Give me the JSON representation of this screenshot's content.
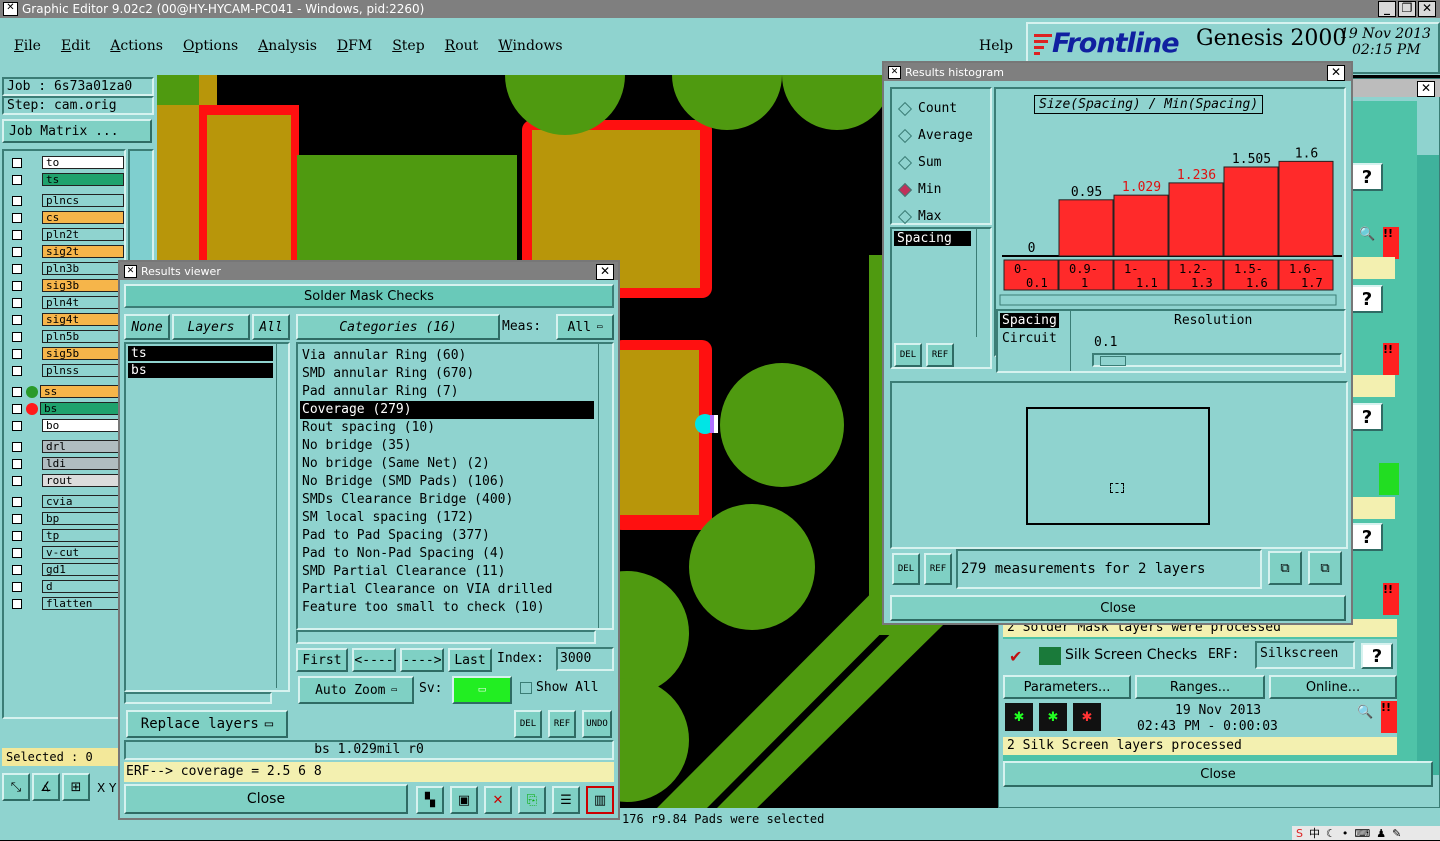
{
  "window": {
    "title": "Graphic Editor 9.02c2 (00@HY-HYCAM-PC041 - Windows, pid:2260)"
  },
  "menu": [
    "File",
    "Edit",
    "Actions",
    "Options",
    "Analysis",
    "DFM",
    "Step",
    "Rout",
    "Windows"
  ],
  "help": "Help",
  "brand": {
    "logo": "Frontline",
    "product": "Genesis 2000",
    "date": "19 Nov 2013",
    "time": "02:15 PM"
  },
  "left_panel": {
    "job": "Job : 6s73a01za0",
    "step": "Step: cam.orig",
    "job_matrix": "Job Matrix ...",
    "layers": [
      {
        "name": "to",
        "color": "#ffffff"
      },
      {
        "name": "ts",
        "color": "#1fa26d"
      },
      {
        "name": "plncs",
        "color": "#8fd3cf"
      },
      {
        "name": "cs",
        "color": "#f6b54a"
      },
      {
        "name": "pln2t",
        "color": "#8fd3cf"
      },
      {
        "name": "sig2t",
        "color": "#f6b54a"
      },
      {
        "name": "pln3b",
        "color": "#8fd3cf"
      },
      {
        "name": "sig3b",
        "color": "#f6b54a"
      },
      {
        "name": "pln4t",
        "color": "#8fd3cf"
      },
      {
        "name": "sig4t",
        "color": "#f6b54a"
      },
      {
        "name": "pln5b",
        "color": "#8fd3cf"
      },
      {
        "name": "sig5b",
        "color": "#f6b54a"
      },
      {
        "name": "plnss",
        "color": "#8fd3cf"
      },
      {
        "name": "ss",
        "color": "#f6b54a"
      },
      {
        "name": "bs",
        "color": "#1fa26d"
      },
      {
        "name": "bo",
        "color": "#ffffff"
      },
      {
        "name": "drl",
        "color": "#b0bcc0"
      },
      {
        "name": "ldi",
        "color": "#b0bcc0"
      },
      {
        "name": "rout",
        "color": "#dcdcdc"
      },
      {
        "name": "cvia",
        "color": "#8fd3cf"
      },
      {
        "name": "bp",
        "color": "#8fd3cf"
      },
      {
        "name": "tp",
        "color": "#8fd3cf"
      },
      {
        "name": "v-cut",
        "color": "#8fd3cf"
      },
      {
        "name": "gd1",
        "color": "#8fd3cf"
      },
      {
        "name": "d",
        "color": "#8fd3cf"
      },
      {
        "name": "flatten",
        "color": "#8fd3cf"
      }
    ],
    "selected": "Selected : 0"
  },
  "status_line": "176 r9.84 Pads were selected",
  "coord_prefix": "X Y",
  "results_viewer": {
    "title": "Results viewer",
    "header": "Solder Mask Checks",
    "none_btn": "None",
    "layers_btn": "Layers",
    "all_btn": "All",
    "categories_btn": "Categories (16)",
    "meas_label": "Meas:",
    "meas_value": "All",
    "layer_list": [
      "ts",
      "bs"
    ],
    "categories": [
      "Via annular Ring (60)",
      "SMD annular Ring (670)",
      "Pad annular Ring (7)",
      "Coverage (279)",
      "Rout spacing (10)",
      "No bridge (35)",
      "No bridge (Same Net) (2)",
      "No Bridge (SMD Pads) (106)",
      "SMDs Clearance Bridge (400)",
      "SM local spacing (172)",
      "Pad to Pad Spacing (377)",
      "Pad to Non-Pad Spacing (4)",
      "SMD Partial Clearance (11)",
      "Partial Clearance on VIA drilled",
      "Feature too small to check (10)"
    ],
    "selected_category": "Coverage (279)",
    "first": "First",
    "prev": "<----",
    "next": "---->",
    "last": "Last",
    "index_label": "Index:",
    "index_value": "3000",
    "auto_zoom": "Auto Zoom",
    "sv_label": "Sv:",
    "show_all": "Show All",
    "replace_layers": "Replace layers",
    "del": "DEL",
    "ref": "REF",
    "undo": "UNDO",
    "info": "bs 1.029mil  r0",
    "erf": "ERF--> coverage = 2.5 6 8",
    "close": "Close"
  },
  "histogram": {
    "title": "Results histogram",
    "options": [
      "Count",
      "Average",
      "Sum",
      "Min",
      "Max"
    ],
    "selected_option": "Min",
    "chart_title": "Size(Spacing) / Min(Spacing)",
    "field_list": [
      "Spacing"
    ],
    "resolution_list": [
      "Spacing",
      "Circuit"
    ],
    "resolution_label": "Resolution",
    "resolution_value": "0.1",
    "del": "DEL",
    "ref": "REF",
    "summary": "279 measurements for 2 layers",
    "close": "Close"
  },
  "chart_data": {
    "type": "bar",
    "title": "Size(Spacing) / Min(Spacing)",
    "categories": [
      "0-\n0.1",
      "0.9-\n1",
      "1-\n1.1",
      "1.2-\n1.3",
      "1.5-\n1.6",
      "1.6-\n1.7"
    ],
    "values": [
      0,
      0.95,
      1.029,
      1.236,
      1.505,
      1.6
    ],
    "value_labels": [
      "0",
      "0.95",
      "1.029",
      "1.236",
      "1.505",
      "1.6"
    ],
    "ylim": [
      0,
      1.85
    ],
    "bar_color": "#ff2a2a"
  },
  "checks_panel": {
    "status1": "2 Solder Mask layers were processed",
    "silk_title": "Silk Screen Checks",
    "erf_label": "ERF:",
    "erf_value": "Silkscreen",
    "parameters": "Parameters...",
    "ranges": "Ranges...",
    "online": "Online...",
    "date": "19 Nov 2013",
    "time": "02:43 PM - 0:00:03",
    "status2": "2 Silk Screen layers processed",
    "close": "Close"
  },
  "colors": {
    "teal": "#8fd3cf",
    "green_pad": "#4f9a10",
    "orange_pad": "#b8960a",
    "red_outline": "#ff1010"
  }
}
